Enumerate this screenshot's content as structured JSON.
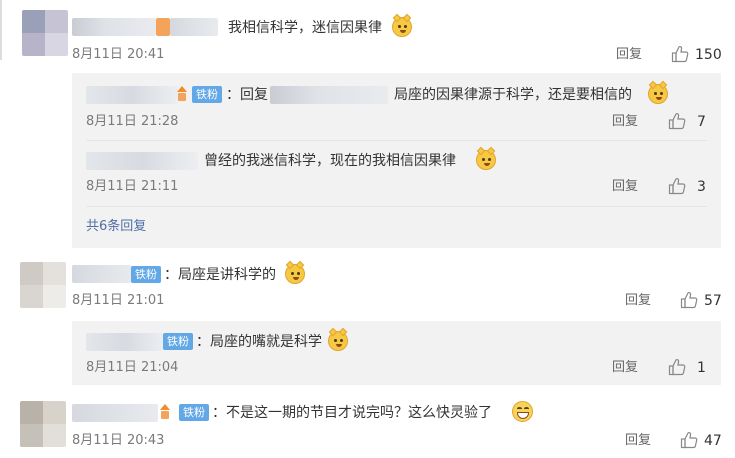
{
  "comments": [
    {
      "text": "我相信科学，迷信因果律",
      "date": "8月11日 20:41",
      "reply_label": "回复",
      "likes": "150",
      "replies": [
        {
          "badge": "铁粉",
          "prefix": "：回复",
          "text": "局座的因果律源于科学，还是要相信的",
          "date": "8月11日 21:28",
          "reply_label": "回复",
          "likes": "7"
        },
        {
          "text": "曾经的我迷信科学，现在的我相信因果律",
          "date": "8月11日 21:11",
          "reply_label": "回复",
          "likes": "3"
        }
      ],
      "more_label": "共6条回复"
    },
    {
      "badge": "铁粉",
      "text": "：局座是讲科学的",
      "date": "8月11日 21:01",
      "reply_label": "回复",
      "likes": "57",
      "replies": [
        {
          "badge": "铁粉",
          "text": "：局座的嘴就是科学",
          "date": "8月11日 21:04",
          "reply_label": "回复",
          "likes": "1"
        }
      ]
    },
    {
      "badge": "铁粉",
      "text": "：不是这一期的节目才说完吗？这么快灵验了",
      "date": "8月11日 20:43",
      "reply_label": "回复",
      "likes": "47"
    }
  ],
  "icons": {
    "like": "thumbs-up-icon",
    "emoji_cat": "cat-face-emoji-icon",
    "emoji_grin": "grinning-face-emoji-icon",
    "fan_medal": "fan-medal-icon"
  },
  "colors": {
    "badge_bg": "#62a7e6",
    "more_link": "#4f6fa6",
    "subcomment_bg": "#f2f2f2"
  }
}
